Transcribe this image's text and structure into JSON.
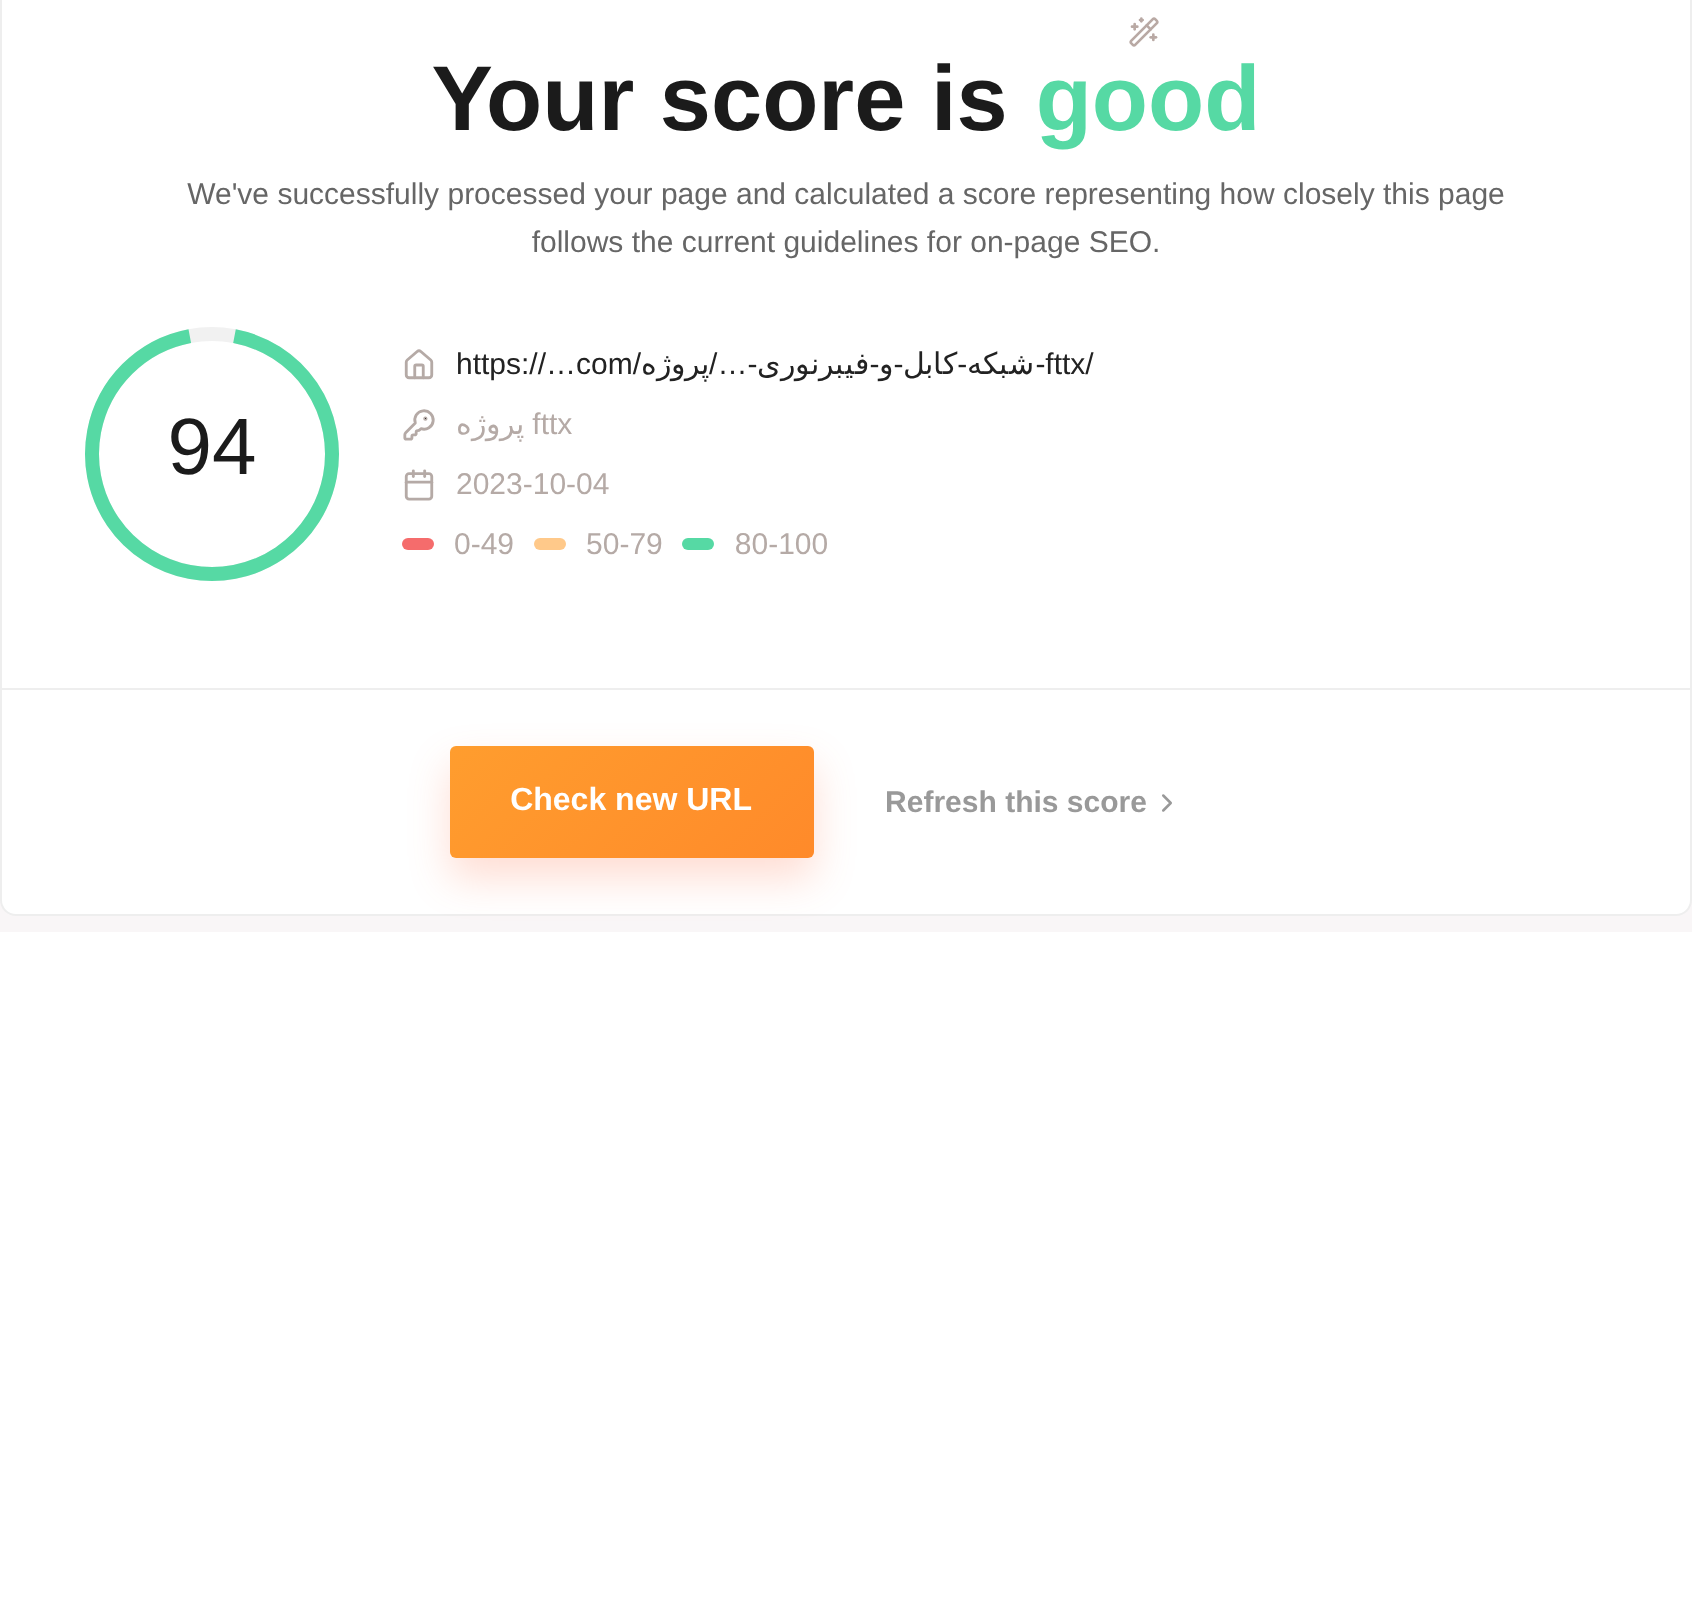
{
  "header": {
    "title": "Your score is",
    "rating": "good",
    "description": "We've successfully processed your page and calculated a score representing how closely this page follows the current guidelines for on-page SEO."
  },
  "score": {
    "value": "94",
    "level": 0.94
  },
  "details": [
    {
      "kind": "url",
      "text": "https://…com/شبکه-کابل-و-فیبرنوری-…/پروژه-fttx/"
    },
    {
      "kind": "keyword",
      "text": "پروژه fttx"
    },
    {
      "kind": "date",
      "text": "2023-10-04"
    }
  ],
  "legend": [
    {
      "label": "0-49",
      "color": "#f56c6c"
    },
    {
      "label": "50-79",
      "color": "#ffc98a"
    },
    {
      "label": "80-100",
      "color": "#56d9a4"
    }
  ],
  "actions": {
    "primary": "Check new URL",
    "secondary": "Refresh this score"
  }
}
